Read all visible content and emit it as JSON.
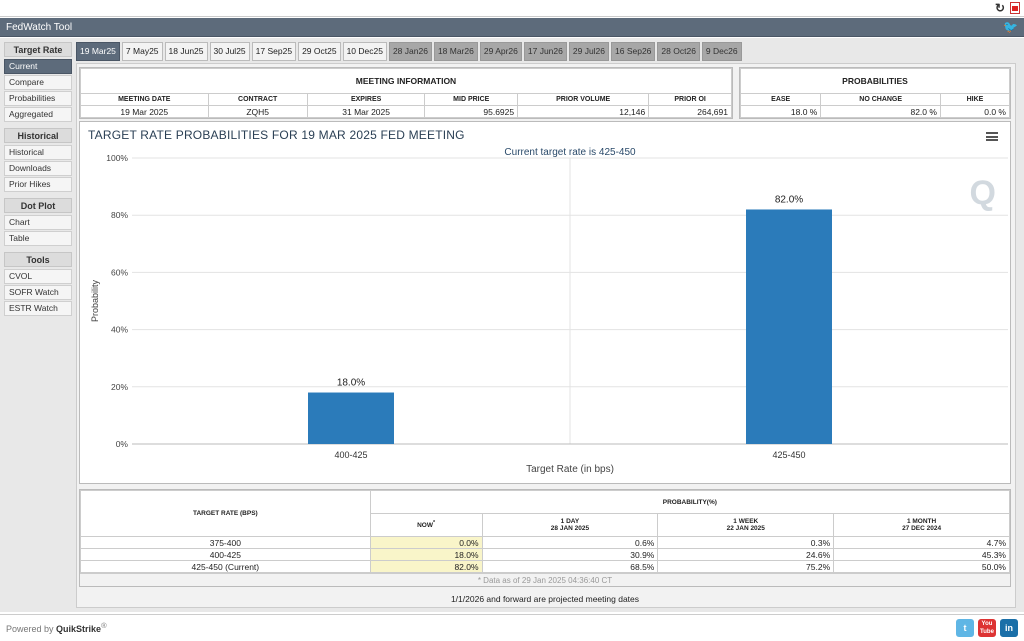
{
  "topbar": {
    "refresh_icon": "refresh-icon",
    "pdf_icon": "pdf-icon"
  },
  "window": {
    "title": "FedWatch Tool",
    "twitter_icon": "twitter-icon"
  },
  "sidebar": {
    "groups": [
      {
        "title": "Target Rate",
        "items": [
          "Current",
          "Compare",
          "Probabilities",
          "Aggregated"
        ]
      },
      {
        "title": "Historical",
        "items": [
          "Historical",
          "Downloads",
          "Prior Hikes"
        ]
      },
      {
        "title": "Dot Plot",
        "items": [
          "Chart",
          "Table"
        ]
      },
      {
        "title": "Tools",
        "items": [
          "CVOL",
          "SOFR Watch",
          "ESTR Watch"
        ]
      }
    ],
    "active_item": "Current"
  },
  "tabs": [
    {
      "label": "19 Mar25",
      "state": "active"
    },
    {
      "label": "7 May25",
      "state": "normal"
    },
    {
      "label": "18 Jun25",
      "state": "normal"
    },
    {
      "label": "30 Jul25",
      "state": "normal"
    },
    {
      "label": "17 Sep25",
      "state": "normal"
    },
    {
      "label": "29 Oct25",
      "state": "normal"
    },
    {
      "label": "10 Dec25",
      "state": "normal"
    },
    {
      "label": "28 Jan26",
      "state": "dim"
    },
    {
      "label": "18 Mar26",
      "state": "dim"
    },
    {
      "label": "29 Apr26",
      "state": "dim"
    },
    {
      "label": "17 Jun26",
      "state": "dim"
    },
    {
      "label": "29 Jul26",
      "state": "dim"
    },
    {
      "label": "16 Sep26",
      "state": "dim"
    },
    {
      "label": "28 Oct26",
      "state": "dim"
    },
    {
      "label": "9 Dec26",
      "state": "dim"
    }
  ],
  "meeting_info": {
    "caption": "MEETING INFORMATION",
    "headers": [
      "MEETING DATE",
      "CONTRACT",
      "EXPIRES",
      "MID PRICE",
      "PRIOR VOLUME",
      "PRIOR OI"
    ],
    "values": [
      "19 Mar 2025",
      "ZQH5",
      "31 Mar 2025",
      "95.6925",
      "12,146",
      "264,691"
    ]
  },
  "probabilities": {
    "caption": "PROBABILITIES",
    "headers": [
      "EASE",
      "NO CHANGE",
      "HIKE"
    ],
    "values": [
      "18.0 %",
      "82.0 %",
      "0.0 %"
    ]
  },
  "chart_data": {
    "type": "bar",
    "title": "TARGET RATE PROBABILITIES FOR 19 MAR 2025 FED MEETING",
    "subtitle": "Current target rate is 425-450",
    "xlabel": "Target Rate (in bps)",
    "ylabel": "Probability",
    "categories": [
      "400-425",
      "425-450"
    ],
    "values": [
      18.0,
      82.0
    ],
    "data_labels": [
      "18.0%",
      "82.0%"
    ],
    "yticks": [
      "0%",
      "20%",
      "40%",
      "60%",
      "80%",
      "100%"
    ],
    "ylim": [
      0,
      100
    ],
    "bar_color": "#2b7bba",
    "grid": true,
    "menu_icon": "hamburger-menu-icon",
    "watermark_icon": "quikstrike-q-logo"
  },
  "prob_table": {
    "col_target": "TARGET RATE (BPS)",
    "col_group": "PROBABILITY(%)",
    "sub_headers": [
      {
        "line1": "NOW",
        "line2": "",
        "mark": "*"
      },
      {
        "line1": "1 DAY",
        "line2": "28 JAN 2025"
      },
      {
        "line1": "1 WEEK",
        "line2": "22 JAN 2025"
      },
      {
        "line1": "1 MONTH",
        "line2": "27 DEC 2024"
      }
    ],
    "rows": [
      {
        "rate": "375-400",
        "now": "0.0%",
        "day": "0.6%",
        "week": "0.3%",
        "month": "4.7%"
      },
      {
        "rate": "400-425",
        "now": "18.0%",
        "day": "30.9%",
        "week": "24.6%",
        "month": "45.3%"
      },
      {
        "rate": "425-450 (Current)",
        "now": "82.0%",
        "day": "68.5%",
        "week": "75.2%",
        "month": "50.0%"
      }
    ],
    "footnote": "* Data as of 29 Jan 2025 04:36:40 CT"
  },
  "projected_note": "1/1/2026 and forward are projected meeting dates",
  "footer": {
    "powered_prefix": "Powered by",
    "powered_brand": "QuikStrike",
    "powered_mark": "®",
    "social": [
      {
        "icon": "twitter-icon",
        "label": "t"
      },
      {
        "icon": "youtube-icon",
        "label": "You Tube"
      },
      {
        "icon": "linkedin-icon",
        "label": "in"
      }
    ]
  }
}
